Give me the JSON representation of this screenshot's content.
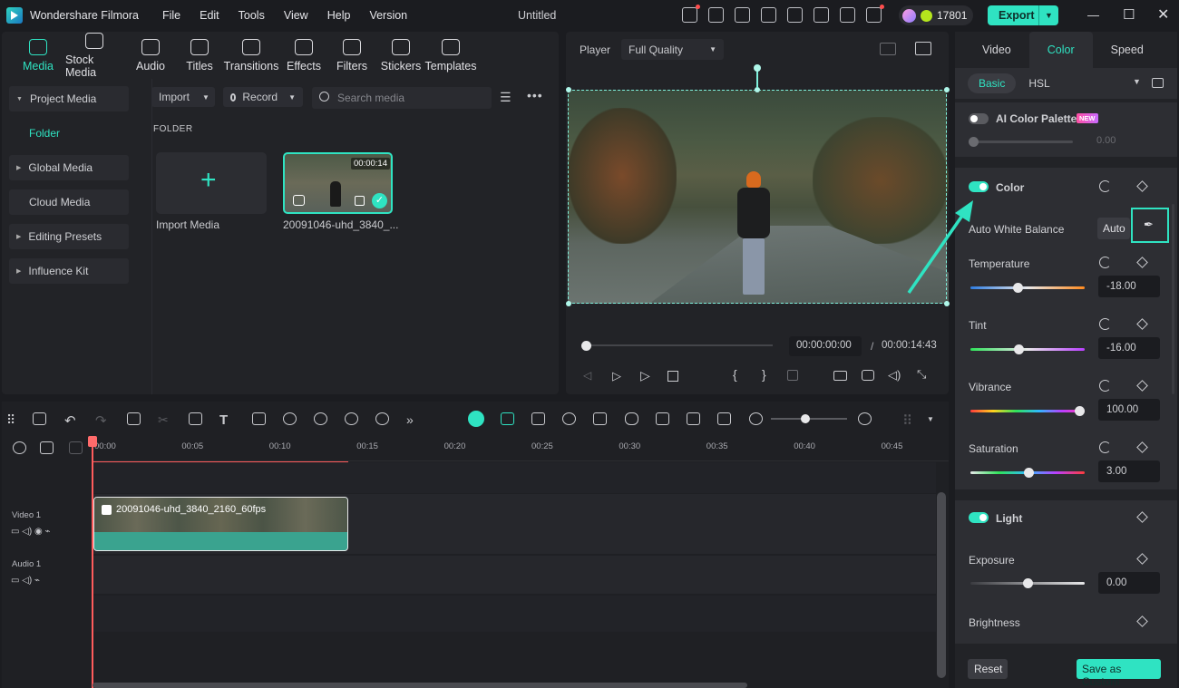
{
  "app": {
    "name": "Wondershare Filmora",
    "doc_title": "Untitled",
    "credits": "17801",
    "export": "Export"
  },
  "menu": [
    "File",
    "Edit",
    "Tools",
    "View",
    "Help",
    "Version"
  ],
  "media_tabs": [
    "Media",
    "Stock Media",
    "Audio",
    "Titles",
    "Transitions",
    "Effects",
    "Filters",
    "Stickers",
    "Templates"
  ],
  "sidebar": {
    "project_media": "Project Media",
    "folder": "Folder",
    "global_media": "Global Media",
    "cloud_media": "Cloud Media",
    "editing_presets": "Editing Presets",
    "influence_kit": "Influence Kit"
  },
  "toolbar": {
    "import": "Import",
    "record": "Record",
    "search_placeholder": "Search media"
  },
  "folder_label": "FOLDER",
  "media_items": [
    {
      "label": "Import Media"
    },
    {
      "label": "20091046-uhd_3840_...",
      "duration": "00:00:14"
    }
  ],
  "player": {
    "label": "Player",
    "quality": "Full Quality",
    "current": "00:00:00:00",
    "sep": "/",
    "total": "00:00:14:43"
  },
  "props": {
    "tabs": [
      "Video",
      "Color",
      "Speed"
    ],
    "subtabs": [
      "Basic",
      "HSL"
    ],
    "ai_palette": "AI Color Palette",
    "new_badge": "NEW",
    "ai_value": "0.00",
    "color": "Color",
    "awb": "Auto White Balance",
    "auto": "Auto",
    "temperature": {
      "label": "Temperature",
      "value": "-18.00",
      "level": 0.41
    },
    "tint": {
      "label": "Tint",
      "value": "-16.00",
      "level": 0.42
    },
    "vibrance": {
      "label": "Vibrance",
      "value": "100.00",
      "level": 1.0
    },
    "saturation": {
      "label": "Saturation",
      "value": "3.00",
      "level": 0.51
    },
    "light": "Light",
    "exposure": {
      "label": "Exposure",
      "value": "0.00",
      "level": 0.5
    },
    "brightness": {
      "label": "Brightness"
    },
    "reset": "Reset",
    "save_custom": "Save as Custom"
  },
  "timeline": {
    "ticks": [
      "00:00",
      "00:05",
      "00:10",
      "00:15",
      "00:20",
      "00:25",
      "00:30",
      "00:35",
      "00:40",
      "00:45"
    ],
    "video_track": "Video 1",
    "audio_track": "Audio 1",
    "clip_name": "20091046-uhd_3840_2160_60fps"
  },
  "colors": {
    "accent": "#2fe3c2",
    "playhead": "#ff5c5c"
  }
}
